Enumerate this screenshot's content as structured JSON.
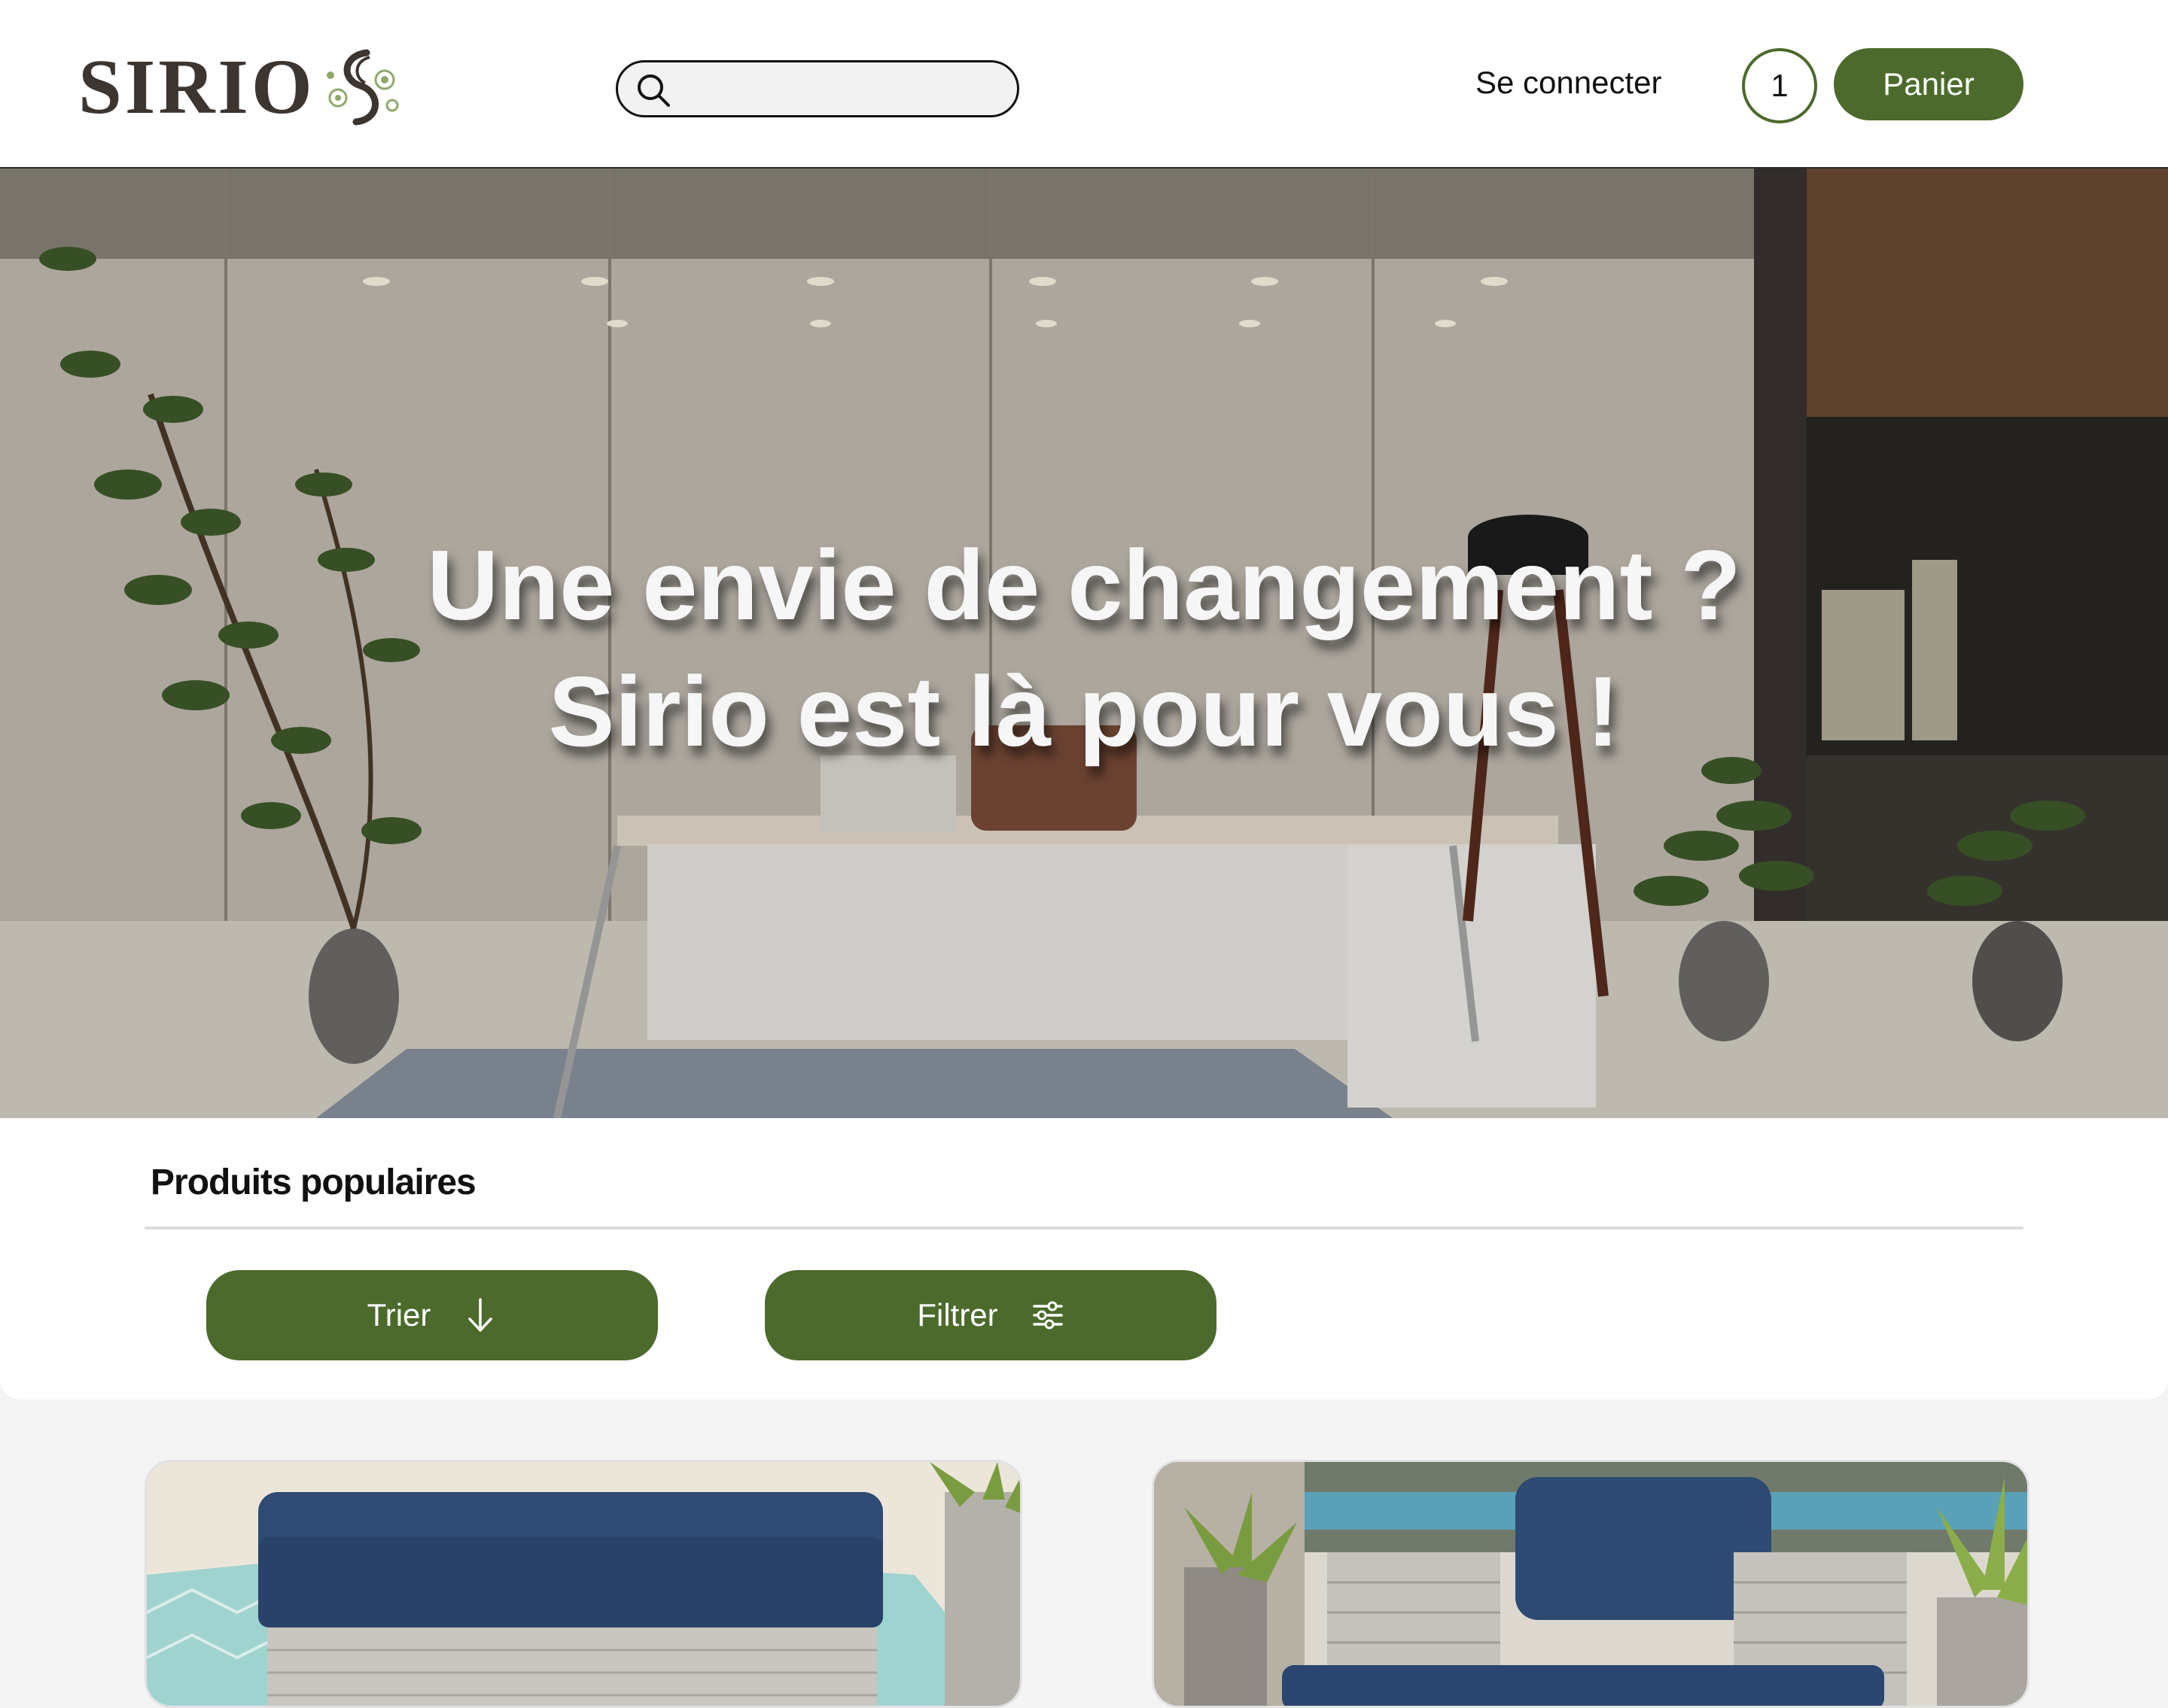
{
  "header": {
    "logo_text": "SIRIO",
    "search": {
      "placeholder": "",
      "value": ""
    },
    "login_label": "Se connecter",
    "cart_count": "1",
    "cart_label": "Panier"
  },
  "hero": {
    "line1": "Une envie de changement ?",
    "line2": "Sirio est là pour vous !"
  },
  "section": {
    "title": "Produits populaires",
    "sort_label": "Trier",
    "filter_label": "Filtrer"
  },
  "products": [
    {
      "image": "blue-cushion-wicker-ottoman"
    },
    {
      "image": "blue-cushion-wicker-armchair"
    }
  ],
  "colors": {
    "accent": "#4c6a2c",
    "text": "#111111",
    "page_bg": "#f4f4f4"
  }
}
